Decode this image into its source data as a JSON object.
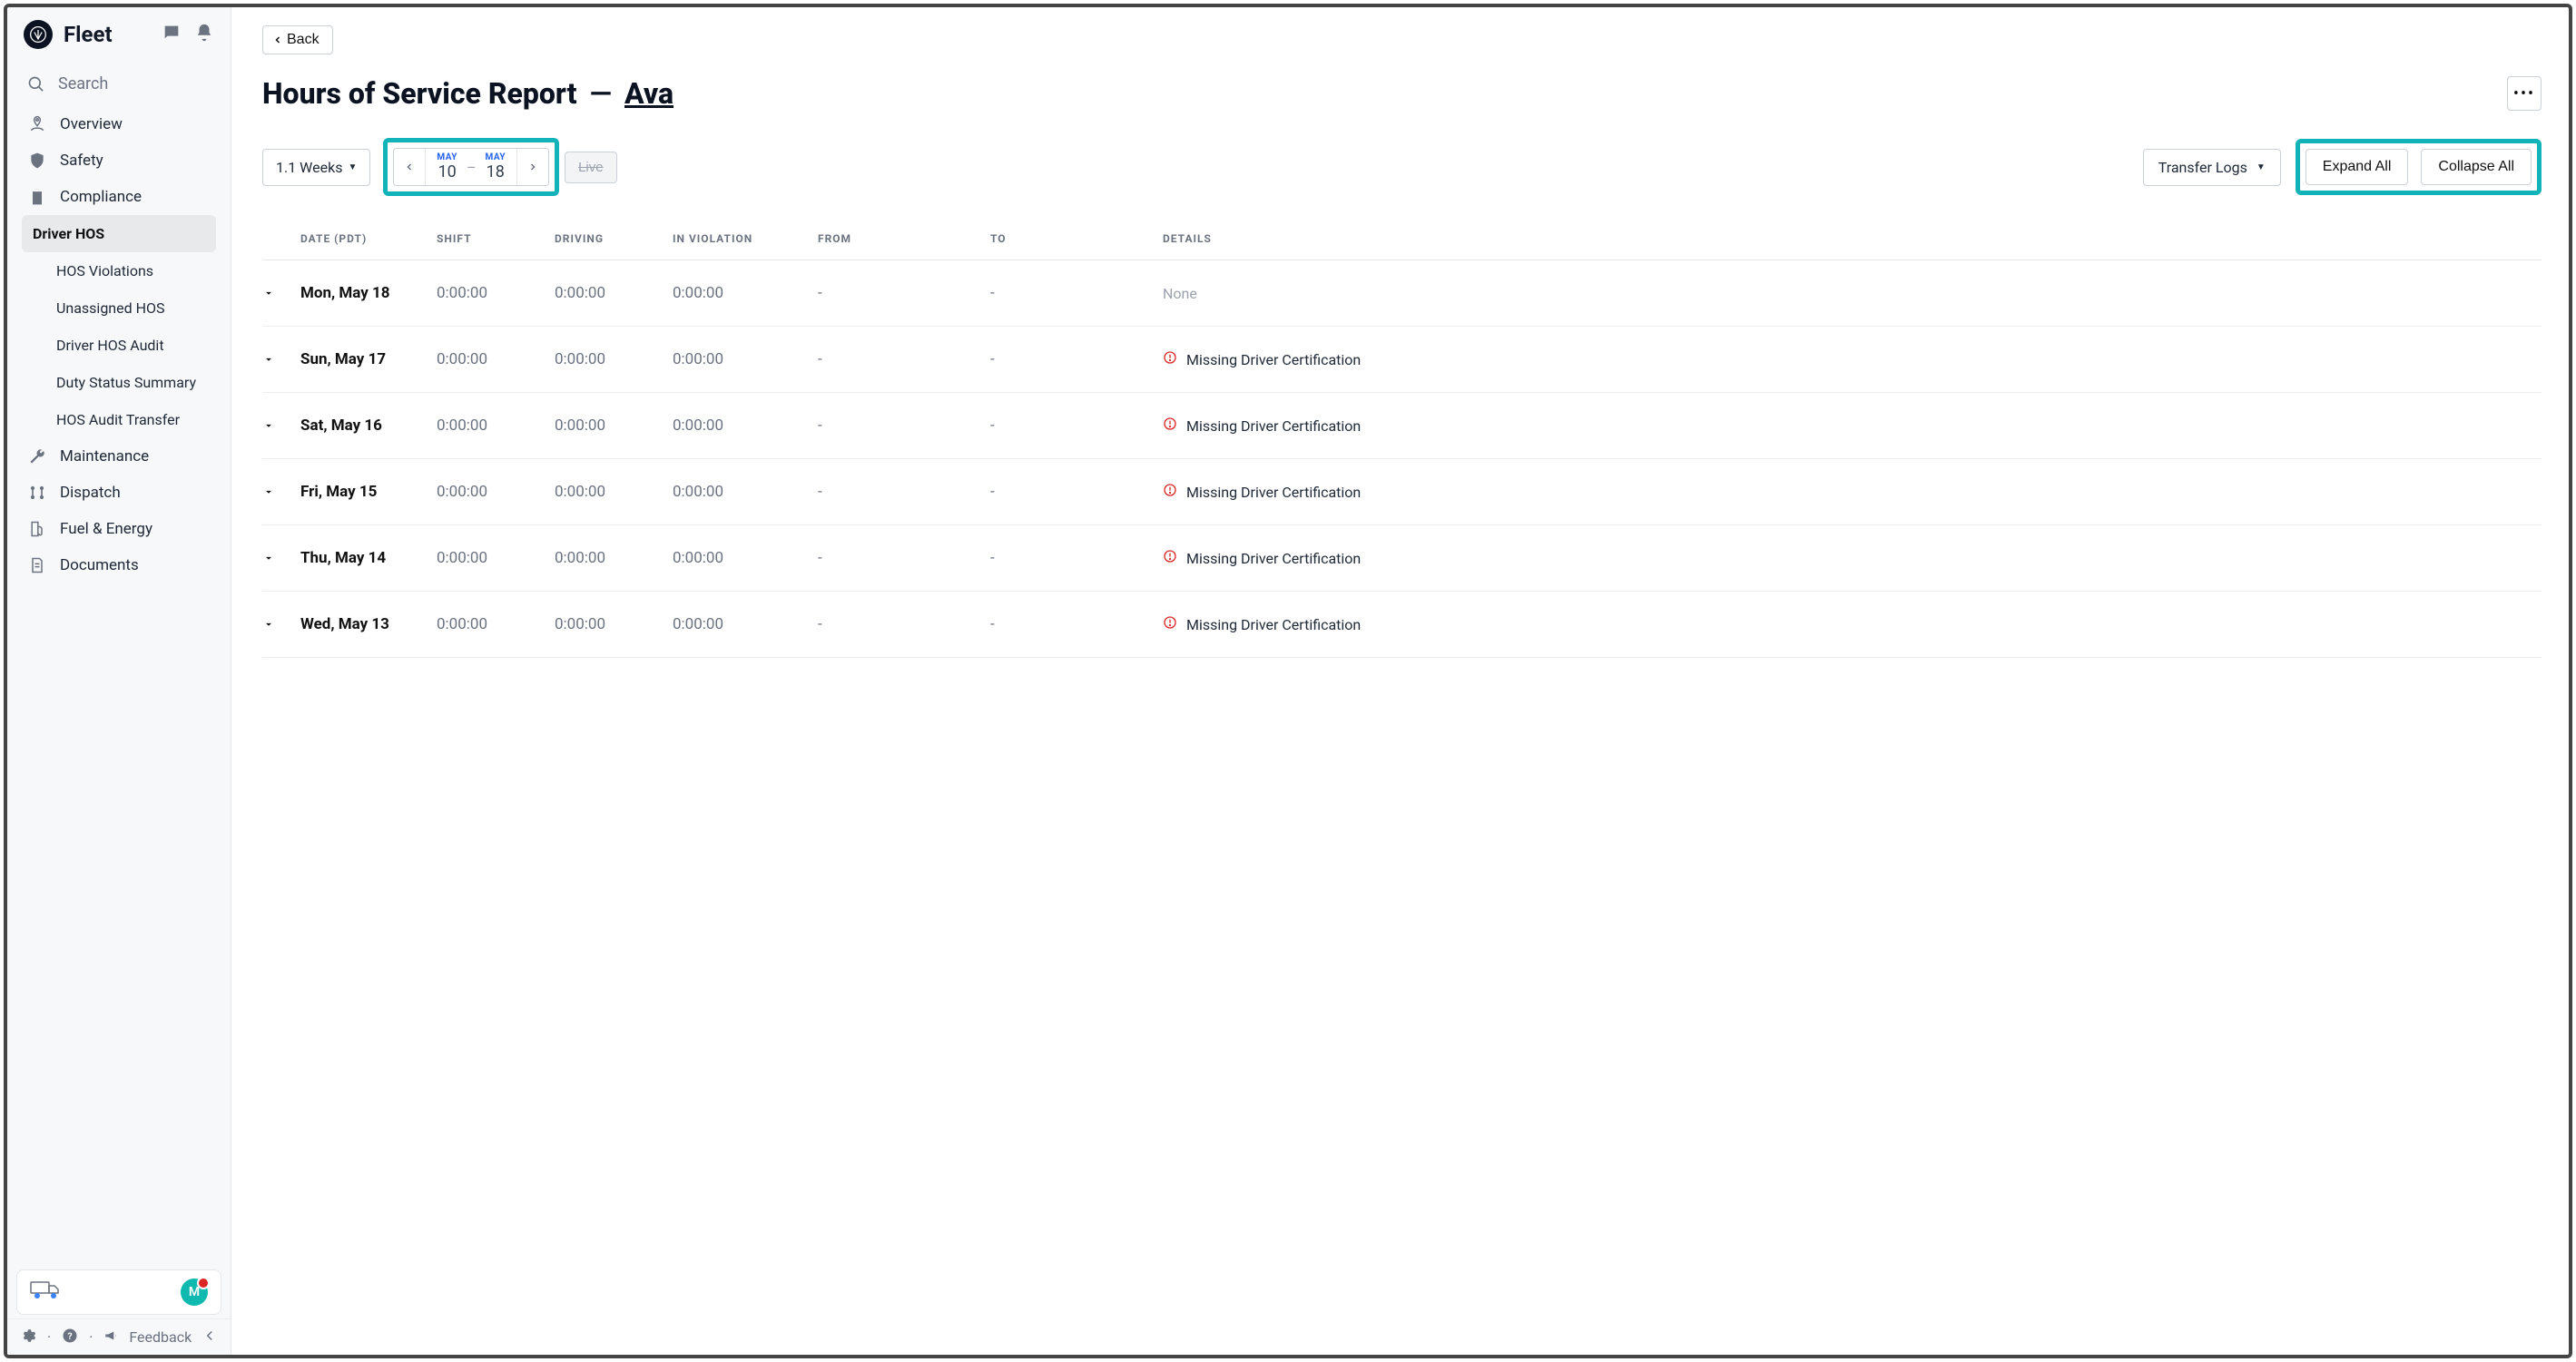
{
  "app": {
    "brand": "Fleet"
  },
  "sidebar": {
    "search_label": "Search",
    "items": [
      {
        "label": "Overview"
      },
      {
        "label": "Safety"
      },
      {
        "label": "Compliance"
      },
      {
        "label": "Maintenance"
      },
      {
        "label": "Dispatch"
      },
      {
        "label": "Fuel & Energy"
      },
      {
        "label": "Documents"
      }
    ],
    "compliance_sub": [
      {
        "label": "Driver HOS",
        "active": true
      },
      {
        "label": "HOS Violations"
      },
      {
        "label": "Unassigned HOS"
      },
      {
        "label": "Driver HOS Audit"
      },
      {
        "label": "Duty Status Summary"
      },
      {
        "label": "HOS Audit Transfer"
      }
    ],
    "avatar_initial": "M",
    "footer": {
      "feedback": "Feedback"
    }
  },
  "header": {
    "back_label": "Back",
    "title_prefix": "Hours of Service Report",
    "dash": " — ",
    "driver_name": "Ava"
  },
  "toolbar": {
    "weeks_label": "1.1 Weeks",
    "date_range": {
      "start_month": "MAY",
      "start_day": "10",
      "end_month": "MAY",
      "end_day": "18",
      "dash": "–"
    },
    "live_label": "Live",
    "transfer_label": "Transfer Logs",
    "expand_label": "Expand All",
    "collapse_label": "Collapse All"
  },
  "table": {
    "headers": {
      "date": "DATE (PDT)",
      "shift": "SHIFT",
      "driving": "DRIVING",
      "in_violation": "IN VIOLATION",
      "from": "FROM",
      "to": "TO",
      "details": "DETAILS"
    },
    "none_label": "None",
    "missing_cert_label": "Missing Driver Certification",
    "rows": [
      {
        "date": "Mon, May 18",
        "shift": "0:00:00",
        "driving": "0:00:00",
        "in_violation": "0:00:00",
        "from": "-",
        "to": "-",
        "details_type": "none"
      },
      {
        "date": "Sun, May 17",
        "shift": "0:00:00",
        "driving": "0:00:00",
        "in_violation": "0:00:00",
        "from": "-",
        "to": "-",
        "details_type": "warn"
      },
      {
        "date": "Sat, May 16",
        "shift": "0:00:00",
        "driving": "0:00:00",
        "in_violation": "0:00:00",
        "from": "-",
        "to": "-",
        "details_type": "warn"
      },
      {
        "date": "Fri, May 15",
        "shift": "0:00:00",
        "driving": "0:00:00",
        "in_violation": "0:00:00",
        "from": "-",
        "to": "-",
        "details_type": "warn"
      },
      {
        "date": "Thu, May 14",
        "shift": "0:00:00",
        "driving": "0:00:00",
        "in_violation": "0:00:00",
        "from": "-",
        "to": "-",
        "details_type": "warn"
      },
      {
        "date": "Wed, May 13",
        "shift": "0:00:00",
        "driving": "0:00:00",
        "in_violation": "0:00:00",
        "from": "-",
        "to": "-",
        "details_type": "warn"
      }
    ]
  }
}
